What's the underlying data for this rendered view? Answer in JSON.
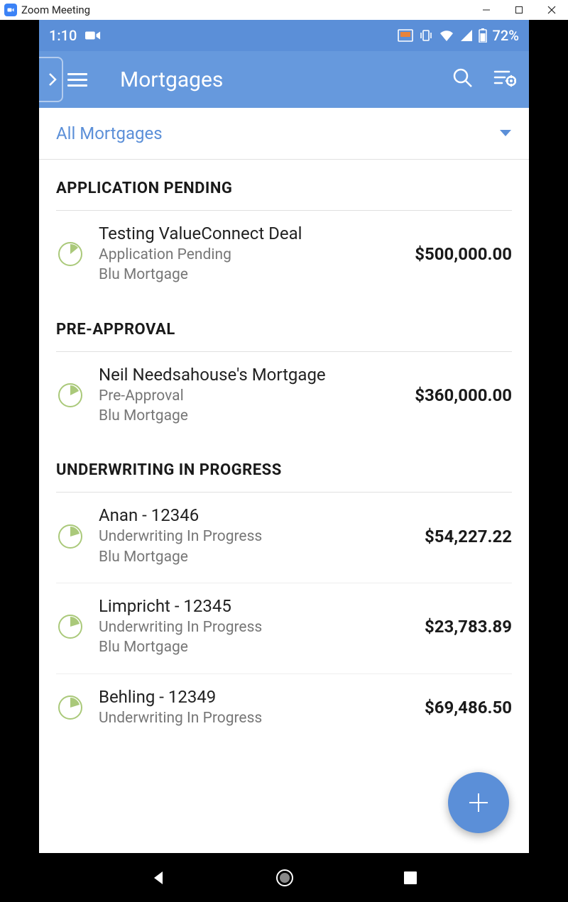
{
  "window": {
    "title": "Zoom Meeting"
  },
  "statusbar": {
    "time": "1:10",
    "battery": "72%"
  },
  "header": {
    "title": "Mortgages"
  },
  "filter": {
    "label": "All Mortgages"
  },
  "sections": [
    {
      "title": "APPLICATION PENDING",
      "items": [
        {
          "title": "Testing ValueConnect Deal",
          "status": "Application Pending",
          "lender": "Blu Mortgage",
          "amount": "$500,000.00"
        }
      ]
    },
    {
      "title": "PRE-APPROVAL",
      "items": [
        {
          "title": "Neil Needsahouse's Mortgage",
          "status": "Pre-Approval",
          "lender": "Blu Mortgage",
          "amount": "$360,000.00"
        }
      ]
    },
    {
      "title": "UNDERWRITING IN PROGRESS",
      "items": [
        {
          "title": "Anan - 12346",
          "status": "Underwriting In Progress",
          "lender": "Blu Mortgage",
          "amount": "$54,227.22"
        },
        {
          "title": "Limpricht - 12345",
          "status": "Underwriting In Progress",
          "lender": "Blu Mortgage",
          "amount": "$23,783.89"
        },
        {
          "title": "Behling - 12349",
          "status": "Underwriting In Progress",
          "lender": "",
          "amount": "$69,486.50"
        }
      ]
    }
  ]
}
